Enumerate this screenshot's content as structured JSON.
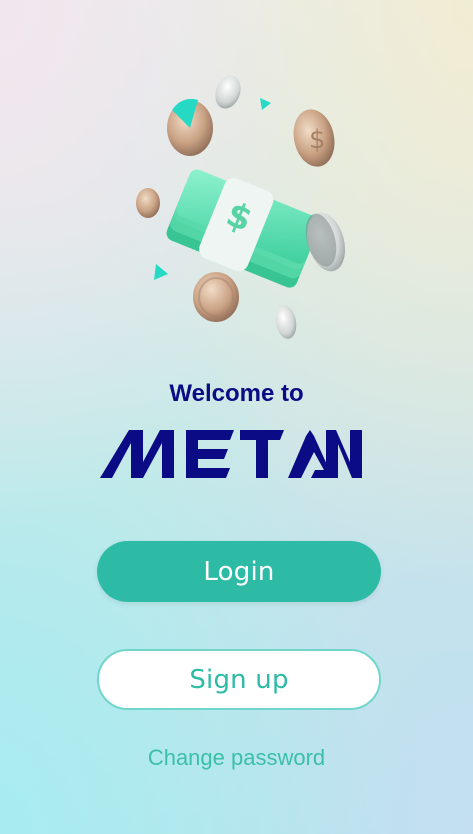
{
  "welcome_text": "Welcome to",
  "brand": {
    "name": "METAN",
    "color": "#0b0b86"
  },
  "actions": {
    "login_label": "Login",
    "signup_label": "Sign up",
    "change_password_label": "Change password"
  },
  "colors": {
    "accent": "#2dbba6",
    "accent_border": "#71d6c9",
    "heading": "#0b0b86"
  },
  "illustration": {
    "icon": "money-stack-with-coins",
    "symbol": "$"
  }
}
